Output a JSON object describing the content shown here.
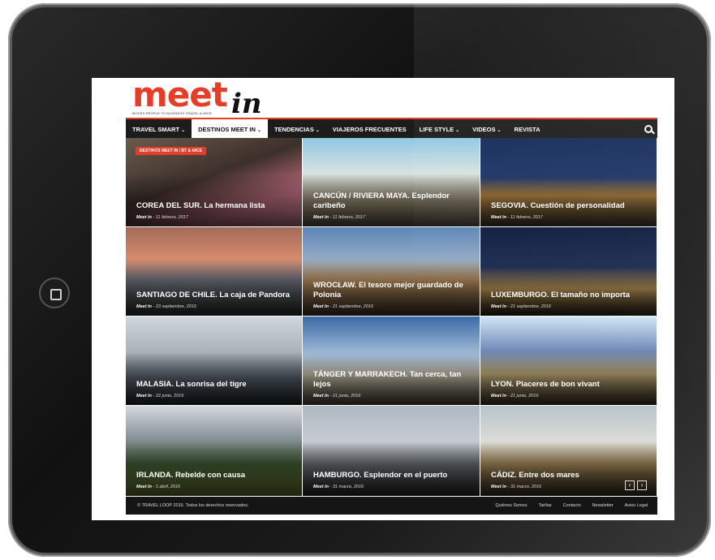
{
  "site": {
    "logo_word": "meet",
    "logo_in": "in",
    "logo_tagline": "MOVES PEOPLE TO BUSINESS TRAVEL & MICE"
  },
  "nav": {
    "items": [
      {
        "label": "TRAVEL SMART",
        "caret": "⌄"
      },
      {
        "label": "DESTINOS MEET IN",
        "caret": "⌄"
      },
      {
        "label": "TENDENCIAS",
        "caret": "⌄"
      },
      {
        "label": "VIAJEROS FRECUENTES",
        "caret": ""
      },
      {
        "label": "LIFE STYLE",
        "caret": "⌄"
      },
      {
        "label": "VIDEOS",
        "caret": "⌄"
      },
      {
        "label": "REVISTA",
        "caret": ""
      }
    ],
    "active_index": 1,
    "search_icon": "search-icon"
  },
  "badge": "DESTINOS MEET IN | BT & MICE",
  "articles": [
    {
      "title": "COREA DEL SUR. La hermana lista",
      "author": "Meet In",
      "date": "11 febrero, 2017"
    },
    {
      "title": "CANCÚN / RIVIERA MAYA. Esplendor caribeño",
      "author": "Meet In",
      "date": "11 febrero, 2017"
    },
    {
      "title": "SEGOVIA. Cuestión de personalidad",
      "author": "Meet In",
      "date": "11 febrero, 2017"
    },
    {
      "title": "SANTIAGO DE CHILE. La caja de Pandora",
      "author": "Meet In",
      "date": "23 septiembre, 2016"
    },
    {
      "title": "WROCŁAW. El tesoro mejor guardado de Polonia",
      "author": "Meet In",
      "date": "21 septiembre, 2016"
    },
    {
      "title": "LUXEMBURGO. El tamaño no importa",
      "author": "Meet In",
      "date": "21 septiembre, 2016"
    },
    {
      "title": "MALASIA. La sonrisa del tigre",
      "author": "Meet In",
      "date": "22 junio, 2016"
    },
    {
      "title": "TÁNGER Y MARRAKECH. Tan cerca, tan lejos",
      "author": "Meet In",
      "date": "21 junio, 2016"
    },
    {
      "title": "LYON. Placeres de bon vivant",
      "author": "Meet In",
      "date": "21 junio, 2016"
    },
    {
      "title": "IRLANDA. Rebelde con causa",
      "author": "Meet In",
      "date": "1 abril, 2016"
    },
    {
      "title": "HAMBURGO. Esplendor en el puerto",
      "author": "Meet In",
      "date": "31 marzo, 2016"
    },
    {
      "title": "CÁDIZ. Entre dos mares",
      "author": "Meet In",
      "date": "31 marzo, 2016"
    }
  ],
  "pager": {
    "prev": "‹",
    "next": "›"
  },
  "footer": {
    "copyright": "© TRAVEL LOOP 2016. Todos los derechos reservados.",
    "links": [
      "Quiénes Somos",
      "Tarifas",
      "Contacto",
      "Newsletter",
      "Aviso Legal"
    ]
  }
}
